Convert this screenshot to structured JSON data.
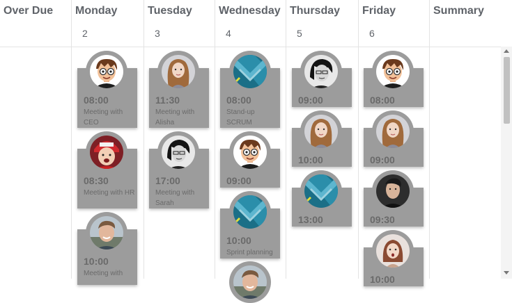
{
  "columns": [
    {
      "name": "Over Due",
      "number": ""
    },
    {
      "name": "Monday",
      "number": "2"
    },
    {
      "name": "Tuesday",
      "number": "3"
    },
    {
      "name": "Wednesday",
      "number": "4"
    },
    {
      "name": "Thursday",
      "number": "5"
    },
    {
      "name": "Friday",
      "number": "6"
    },
    {
      "name": "Summary",
      "number": ""
    }
  ],
  "events": {
    "mon": [
      {
        "time": "08:00",
        "desc": "Meeting with CEO",
        "avatar": "cartoon-boy-avatar"
      },
      {
        "time": "08:30",
        "desc": "Meeting with HR",
        "avatar": "woman-red-hat-avatar"
      },
      {
        "time": "10:00",
        "desc": "Meeting with",
        "avatar": "young-man-avatar"
      }
    ],
    "tue": [
      {
        "time": "11:30",
        "desc": "Meeting with Alisha",
        "avatar": "woman-curly-hair-avatar"
      },
      {
        "time": "17:00",
        "desc": "Meeting with Sarah",
        "avatar": "woman-bw-glasses-avatar"
      }
    ],
    "wed": [
      {
        "time": "08:00",
        "desc": "Stand-up SCRUM",
        "avatar": "blue-logo-avatar"
      },
      {
        "time": "09:00",
        "desc": "",
        "avatar": "cartoon-boy-avatar"
      },
      {
        "time": "10:00",
        "desc": "Sprint planning",
        "avatar": "blue-logo-avatar"
      }
    ],
    "thu": [
      {
        "time": "09:00",
        "desc": "",
        "avatar": "woman-bw-glasses-avatar"
      },
      {
        "time": "10:00",
        "desc": "",
        "avatar": "woman-curly-hair-avatar"
      },
      {
        "time": "13:00",
        "desc": "",
        "avatar": "blue-logo-avatar"
      }
    ],
    "fri": [
      {
        "time": "08:00",
        "desc": "",
        "avatar": "cartoon-boy-avatar"
      },
      {
        "time": "09:00",
        "desc": "",
        "avatar": "woman-curly-hair-avatar"
      },
      {
        "time": "09:30",
        "desc": "",
        "avatar": "young-man-dark-avatar"
      },
      {
        "time": "10:00",
        "desc": "",
        "avatar": "woman-surprised-avatar"
      }
    ]
  }
}
